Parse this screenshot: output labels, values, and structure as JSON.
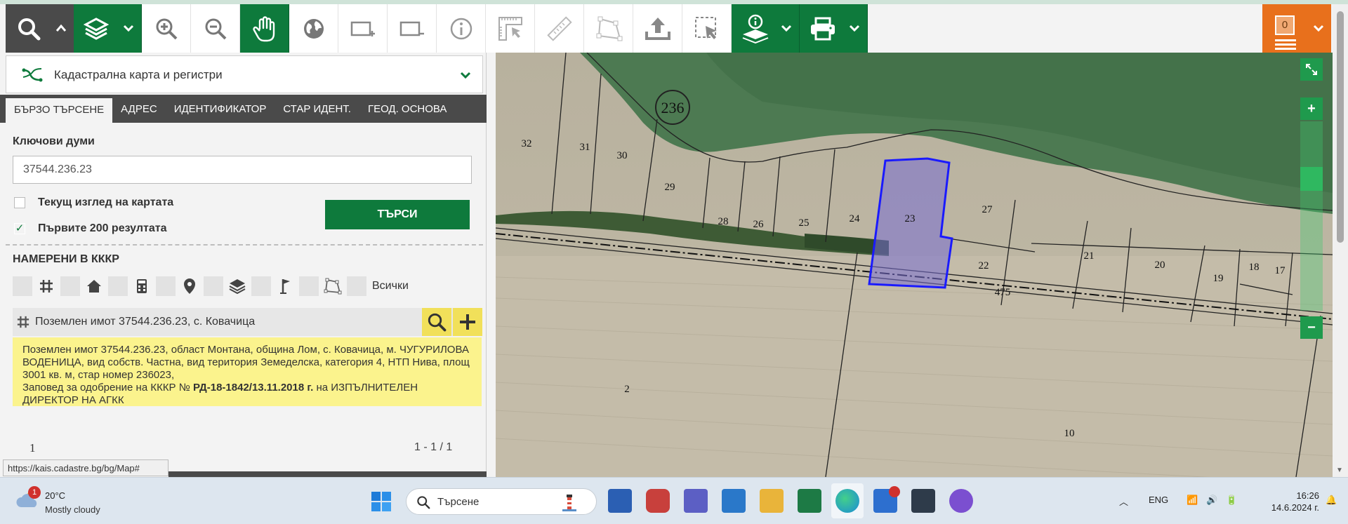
{
  "toolbar": {
    "icons": [
      "search-icon",
      "layers-icon",
      "zoom-in-icon",
      "zoom-out-icon",
      "pan-hand-icon",
      "globe-icon",
      "add-rectangle-icon",
      "remove-rectangle-icon",
      "info-icon",
      "measure-grid-icon",
      "ruler-icon",
      "polygon-icon",
      "upload-icon",
      "select-area-icon",
      "layer-info-icon",
      "print-icon"
    ],
    "cart_count": "0",
    "accent": "#0e7a3c",
    "orange": "#e8701c"
  },
  "panel": {
    "layer_name": "Кадастрална карта и регистри",
    "tabs": [
      "БЪРЗО ТЪРСЕНЕ",
      "АДРЕС",
      "ИДЕНТИФИКАТОР",
      "СТАР ИДЕНТ.",
      "ГЕОД. ОСНОВА"
    ],
    "keywords_label": "Ключови думи",
    "keywords_value": "37544.236.23",
    "chk_current_view": "Текущ изглед на картата",
    "chk_first_200": "Първите 200 резултата",
    "chk_first_200_mark": "✓",
    "search_button": "ТЪРСИ",
    "found_label": "НАМЕРЕНИ В КККР",
    "filter_all": "Всички",
    "result_title": "Поземлен имот 37544.236.23, с. Ковачица",
    "result_text_1": "Поземлен имот 37544.236.23, област Монтана, община Лом, с. Ковачица, м. ЧУГУРИЛОВА ВОДЕНИЦА, вид собств. Частна, вид територия Земеделска, категория 4, НТП Нива, площ 3001 кв. м, стар номер 236023,",
    "result_text_2a": "Заповед за одобрение на КККР №",
    "result_text_2b": "РД-18-1842/13.11.2018 г.",
    "result_text_2c": " на ИЗПЪЛНИТЕЛЕН ДИРЕКТОР НА АГКК",
    "page_left": "1",
    "page_right": "1 - 1 / 1",
    "url_tip": "https://kais.cadastre.bg/bg/Map#"
  },
  "map": {
    "labels": [
      {
        "t": "236"
      },
      {
        "t": "32"
      },
      {
        "t": "31"
      },
      {
        "t": "30"
      },
      {
        "t": "29"
      },
      {
        "t": "28"
      },
      {
        "t": "26"
      },
      {
        "t": "25"
      },
      {
        "t": "24"
      },
      {
        "t": "23"
      },
      {
        "t": "27"
      },
      {
        "t": "22"
      },
      {
        "t": "21"
      },
      {
        "t": "20"
      },
      {
        "t": "19"
      },
      {
        "t": "18"
      },
      {
        "t": "17"
      },
      {
        "t": "475"
      },
      {
        "t": "2"
      },
      {
        "t": "10"
      }
    ],
    "zoom_in": "+",
    "zoom_out": "−"
  },
  "taskbar": {
    "weather_temp": "20°C",
    "weather_desc": "Mostly cloudy",
    "weather_alert": "1",
    "search_placeholder": "Търсене",
    "lang": "ENG",
    "time": "16:26",
    "date": "14.6.2024 г."
  }
}
